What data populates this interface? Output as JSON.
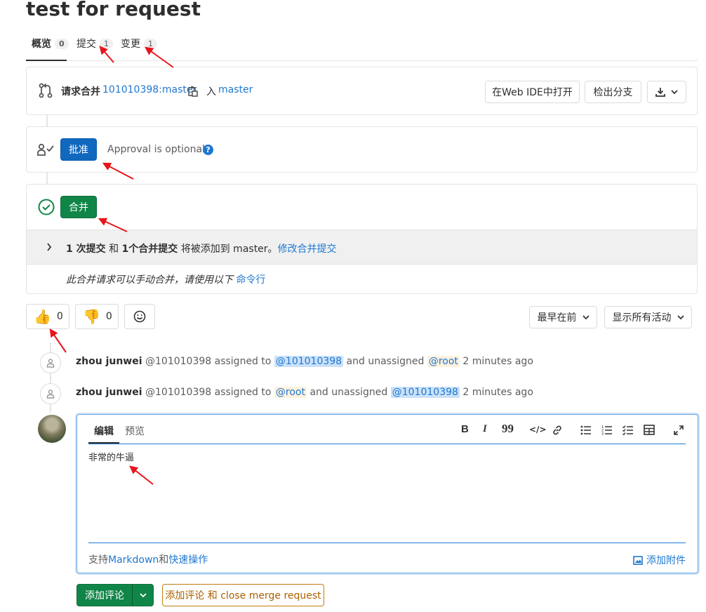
{
  "title": "test for request",
  "tabs": [
    {
      "label": "概览",
      "count": "0"
    },
    {
      "label": "提交",
      "count": "1"
    },
    {
      "label": "变更",
      "count": "1"
    }
  ],
  "merge_info": {
    "label": "请求合并",
    "source_branch": "101010398:master",
    "into": "入",
    "target_branch": "master",
    "open_webide": "在Web IDE中打开",
    "checkout_branch": "检出分支"
  },
  "approval": {
    "approve_label": "批准",
    "optional_text": "Approval is optional",
    "help_glyph": "?"
  },
  "merge": {
    "merge_label": "合并",
    "commit_count": "1 次提交",
    "and": "和",
    "merge_commit": "1个合并提交",
    "will_be_added": "将被添加到 master。",
    "edit_merge_commit": "修改合并提交",
    "manual_text": "此合并请求可以手动合并，请使用以下",
    "command_line": "命令行"
  },
  "awards": {
    "thumbs_up": "👍",
    "thumbs_up_count": "0",
    "thumbs_down": "👎",
    "thumbs_down_count": "0",
    "smiley": "☺"
  },
  "filters": {
    "sort": "最早在前",
    "activity": "显示所有活动"
  },
  "notes": [
    {
      "author": "zhou junwei",
      "username": "@101010398",
      "assigned": "assigned to",
      "assignee": "@101010398",
      "unassigned": "and unassigned",
      "unassignee": "@root",
      "time": "2 minutes ago"
    },
    {
      "author": "zhou junwei",
      "username": "@101010398",
      "assigned": "assigned to",
      "assignee": "@root",
      "unassigned": "and unassigned",
      "unassignee": "@101010398",
      "time": "2 minutes ago"
    }
  ],
  "editor": {
    "tab_write": "编辑",
    "tab_preview": "预览",
    "content": "非常的牛逼",
    "support": "支持",
    "markdown": "Markdown",
    "and": "和",
    "quick_actions": "快速操作",
    "attach": "添加附件",
    "toolbar": {
      "bold": "B",
      "italic": "I",
      "quote": "99",
      "code": "</>"
    }
  },
  "actions": {
    "comment": "添加评论",
    "comment_close": "添加评论 和 close merge request"
  },
  "colors": {
    "annotation_arrow": "#e8141a",
    "approve_blue": "#1068bf",
    "merge_green": "#108548",
    "link_blue": "#1f78d1"
  }
}
